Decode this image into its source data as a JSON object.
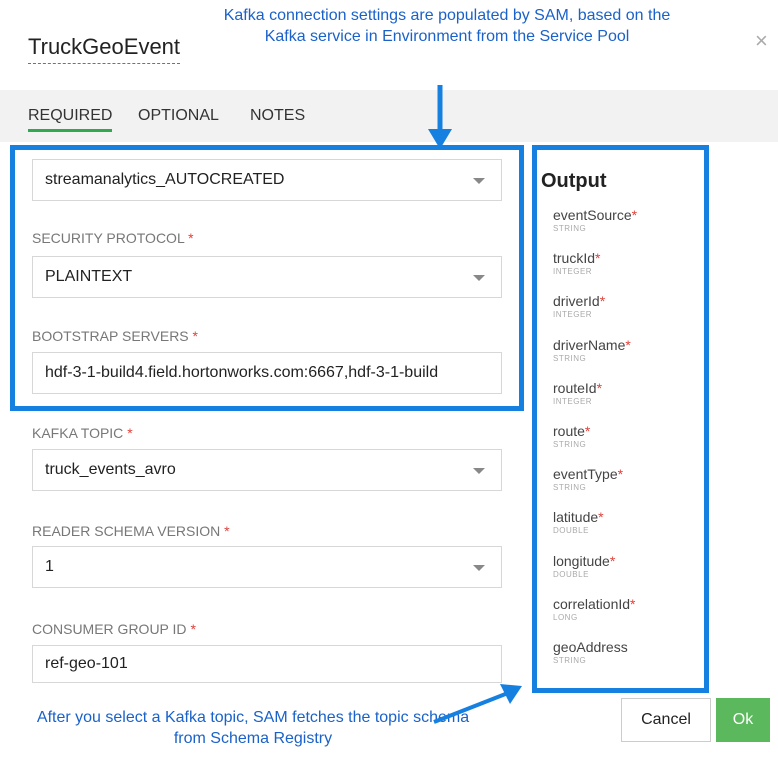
{
  "dialog": {
    "title": "TruckGeoEvent",
    "close_glyph": "×"
  },
  "annotations": {
    "top": "Kafka connection settings are populated by SAM, based on the Kafka service in Environment from the Service Pool",
    "bottom": "After you select a Kafka topic, SAM fetches the topic schema from Schema Registry"
  },
  "tabs": [
    {
      "label": "REQUIRED",
      "active": true
    },
    {
      "label": "OPTIONAL",
      "active": false
    },
    {
      "label": "NOTES",
      "active": false
    }
  ],
  "form": {
    "cluster_value": "streamanalytics_AUTOCREATED",
    "security_protocol": {
      "label": "SECURITY PROTOCOL",
      "value": "PLAINTEXT"
    },
    "bootstrap_servers": {
      "label": "BOOTSTRAP SERVERS",
      "value": "hdf-3-1-build4.field.hortonworks.com:6667,hdf-3-1-build"
    },
    "kafka_topic": {
      "label": "KAFKA TOPIC",
      "value": "truck_events_avro"
    },
    "reader_schema_version": {
      "label": "READER SCHEMA VERSION",
      "value": "1"
    },
    "consumer_group_id": {
      "label": "CONSUMER GROUP ID",
      "value": "ref-geo-101"
    },
    "required_marker": "*"
  },
  "output": {
    "title": "Output",
    "fields": [
      {
        "name": "eventSource",
        "type": "STRING",
        "required": true
      },
      {
        "name": "truckId",
        "type": "INTEGER",
        "required": true
      },
      {
        "name": "driverId",
        "type": "INTEGER",
        "required": true
      },
      {
        "name": "driverName",
        "type": "STRING",
        "required": true
      },
      {
        "name": "routeId",
        "type": "INTEGER",
        "required": true
      },
      {
        "name": "route",
        "type": "STRING",
        "required": true
      },
      {
        "name": "eventType",
        "type": "STRING",
        "required": true
      },
      {
        "name": "latitude",
        "type": "DOUBLE",
        "required": true
      },
      {
        "name": "longitude",
        "type": "DOUBLE",
        "required": true
      },
      {
        "name": "correlationId",
        "type": "LONG",
        "required": true
      },
      {
        "name": "geoAddress",
        "type": "STRING",
        "required": false
      }
    ]
  },
  "buttons": {
    "cancel": "Cancel",
    "ok": "Ok"
  },
  "colors": {
    "annotation_blue": "#1580e0",
    "ok_green": "#5cb85c",
    "required_red": "#e0403a",
    "tab_underline": "#2fa84f"
  }
}
